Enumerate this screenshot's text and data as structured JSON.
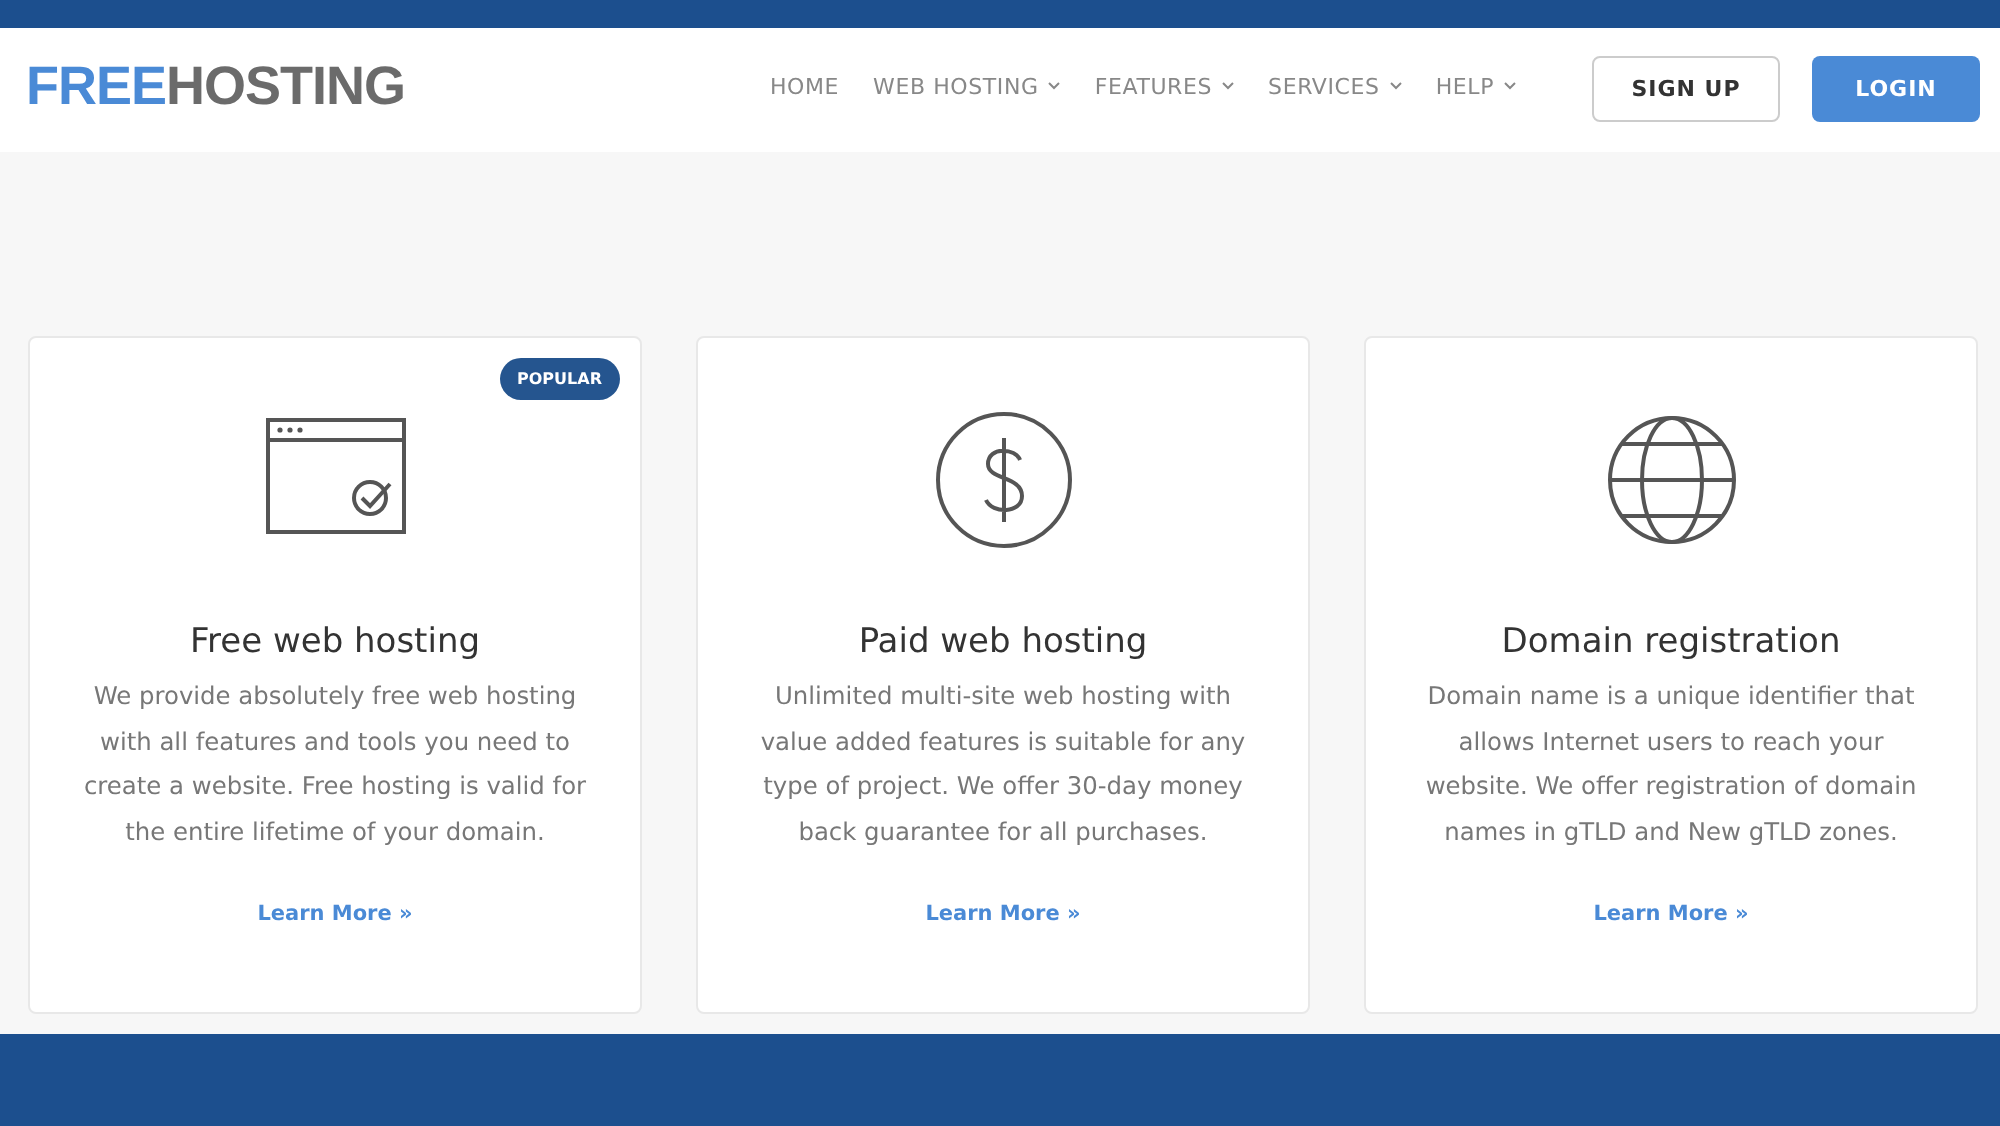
{
  "logo": {
    "first": "FREE",
    "second": "HOSTING"
  },
  "nav": [
    {
      "label": "HOME",
      "has_dropdown": false
    },
    {
      "label": "WEB HOSTING",
      "has_dropdown": true
    },
    {
      "label": "FEATURES",
      "has_dropdown": true
    },
    {
      "label": "SERVICES",
      "has_dropdown": true
    },
    {
      "label": "HELP",
      "has_dropdown": true
    }
  ],
  "buttons": [
    {
      "label": "SIGN UP",
      "kind": "outline"
    },
    {
      "label": "LOGIN",
      "kind": "primary"
    }
  ],
  "cards": [
    {
      "badge": "POPULAR",
      "title": "Free web hosting",
      "text": "We provide absolutely free web hosting with all features and tools you need to create a website. Free hosting is valid for the entire lifetime of your domain.",
      "link": "Learn More »"
    },
    {
      "title": "Paid web hosting",
      "text": "Unlimited multi-site web hosting with value added features is suitable for any type of project. We offer 30-day money back guarantee for all purchases.",
      "link": "Learn More »"
    },
    {
      "title": "Domain registration",
      "text": "Domain name is a unique identifier that allows Internet users to reach your website. We offer registration of domain names in gTLD and New gTLD zones.",
      "link": "Learn More »"
    }
  ]
}
